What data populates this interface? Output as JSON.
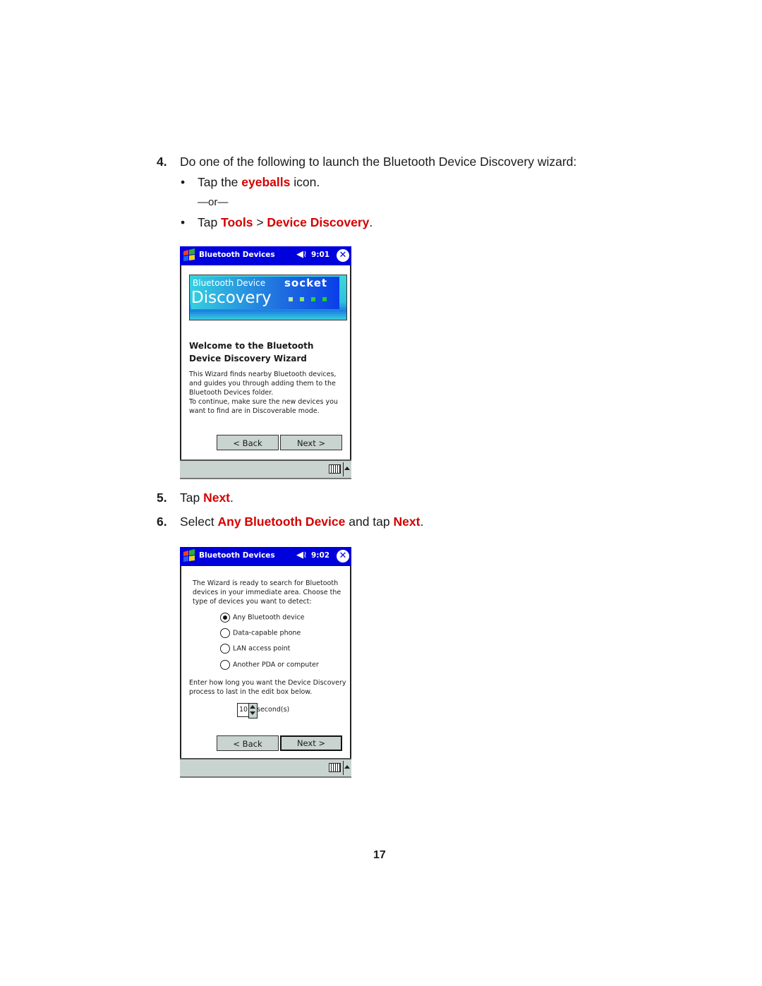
{
  "steps": {
    "step4": {
      "number": "4.",
      "text": "Do one of the following to launch the Bluetooth Device Discovery wizard:",
      "bullet1": {
        "pre": "Tap the ",
        "highlight": "eyeballs",
        "post": " icon."
      },
      "or": "—or—",
      "bullet2": {
        "pre": "Tap ",
        "h1": "Tools",
        "sep": " > ",
        "h2": "Device Discovery",
        "post": "."
      }
    },
    "step5": {
      "number": "5.",
      "pre": "Tap ",
      "highlight": "Next",
      "post": "."
    },
    "step6": {
      "number": "6.",
      "pre": "Select ",
      "h1": "Any Bluetooth Device",
      "mid": " and tap ",
      "h2": "Next",
      "post": "."
    }
  },
  "screen1": {
    "title": "Bluetooth Devices",
    "time": "9:01",
    "banner": {
      "line1": "Bluetooth Device",
      "line2": "Discovery",
      "brand": "socket"
    },
    "heading_line1": "Welcome to the Bluetooth",
    "heading_line2": "Device Discovery Wizard",
    "para1_lines": [
      "This Wizard finds nearby Bluetooth devices,",
      "and guides you through adding them to the",
      "Bluetooth Devices folder."
    ],
    "para2_lines": [
      "To continue, make sure the new devices you",
      "want to find are in Discoverable mode."
    ],
    "back_label": "< Back",
    "next_label": "Next >"
  },
  "screen2": {
    "title": "Bluetooth Devices",
    "time": "9:02",
    "intro_lines": [
      "The Wizard is ready to search for Bluetooth",
      "devices in your immediate area. Choose the",
      "type of devices you want to detect:"
    ],
    "options": [
      {
        "label": "Any Bluetooth device",
        "selected": true
      },
      {
        "label": "Data-capable phone",
        "selected": false
      },
      {
        "label": "LAN access point",
        "selected": false
      },
      {
        "label": "Another PDA or computer",
        "selected": false
      }
    ],
    "duration_lines": [
      "Enter how long you want the Device Discovery",
      "process to last in the edit box below."
    ],
    "duration_value": "10",
    "duration_unit": "second(s)",
    "back_label": "< Back",
    "next_label": "Next >"
  },
  "colors": {
    "highlight": "#d40000",
    "titlebar": "#0000dd"
  },
  "page_number": "17"
}
